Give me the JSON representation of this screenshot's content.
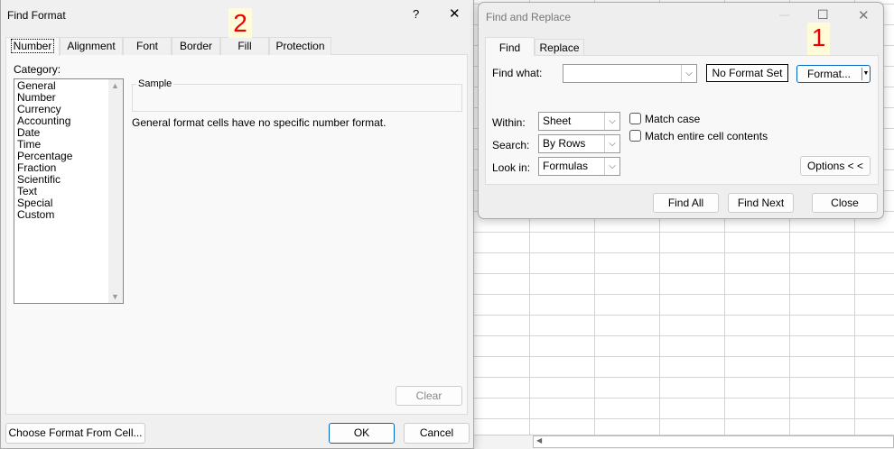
{
  "find_format": {
    "title": "Find Format",
    "help": "?",
    "close": "✕",
    "tabs": [
      "Number",
      "Alignment",
      "Font",
      "Border",
      "Fill",
      "Protection"
    ],
    "category_label": "Category:",
    "categories": [
      "General",
      "Number",
      "Currency",
      "Accounting",
      "Date",
      "Time",
      "Percentage",
      "Fraction",
      "Scientific",
      "Text",
      "Special",
      "Custom"
    ],
    "sample_label": "Sample",
    "description": "General format cells have no specific number format.",
    "clear": "Clear",
    "choose_from_cell": "Choose Format From Cell...",
    "ok": "OK",
    "cancel": "Cancel"
  },
  "find_replace": {
    "title": "Find and Replace",
    "minimize": "—",
    "maximize": "☐",
    "close": "✕",
    "tabs": [
      "Find",
      "Replace"
    ],
    "find_what_label": "Find what:",
    "find_what_value": "",
    "no_format_set": "No Format Set",
    "format_button": "Format...",
    "within_label": "Within:",
    "within_value": "Sheet",
    "search_label": "Search:",
    "search_value": "By Rows",
    "look_in_label": "Look in:",
    "look_in_value": "Formulas",
    "match_case": "Match case",
    "match_entire": "Match entire cell contents",
    "options": "Options < <",
    "find_all": "Find All",
    "find_next": "Find Next",
    "close_button": "Close"
  },
  "annotations": {
    "step1": "1",
    "step2": "2"
  }
}
